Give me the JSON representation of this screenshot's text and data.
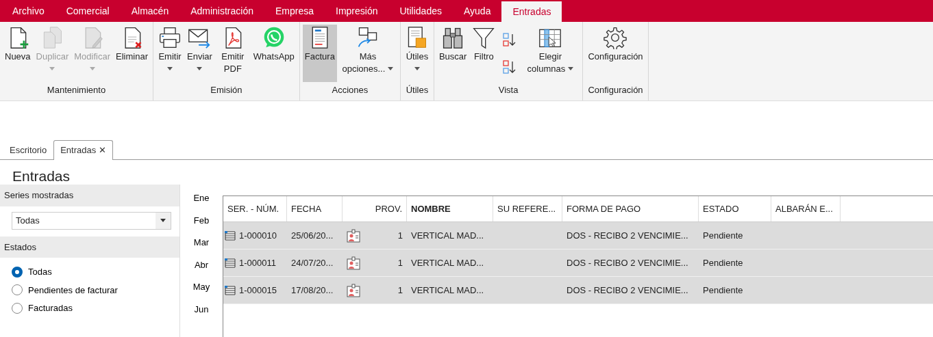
{
  "menu": [
    {
      "label": "Archivo",
      "selected": false
    },
    {
      "label": "Comercial",
      "selected": false
    },
    {
      "label": "Almacén",
      "selected": false
    },
    {
      "label": "Administración",
      "selected": false
    },
    {
      "label": "Empresa",
      "selected": false
    },
    {
      "label": "Impresión",
      "selected": false
    },
    {
      "label": "Utilidades",
      "selected": false
    },
    {
      "label": "Ayuda",
      "selected": false
    },
    {
      "label": "Entradas",
      "selected": true
    }
  ],
  "ribbon": [
    {
      "label": "Mantenimiento",
      "buttons": [
        {
          "kind": "new",
          "label": "Nueva",
          "disabled": false,
          "dropdown": false,
          "selected": false
        },
        {
          "kind": "duplicate",
          "label": "Duplicar",
          "disabled": true,
          "dropdown": true,
          "selected": false
        },
        {
          "kind": "edit",
          "label": "Modificar",
          "disabled": true,
          "dropdown": true,
          "selected": false
        },
        {
          "kind": "delete",
          "label": "Eliminar",
          "disabled": false,
          "dropdown": false,
          "selected": false
        }
      ]
    },
    {
      "label": "Emisión",
      "buttons": [
        {
          "kind": "print",
          "label": "Emitir",
          "disabled": false,
          "dropdown": true,
          "selected": false
        },
        {
          "kind": "mail",
          "label": "Enviar",
          "disabled": false,
          "dropdown": true,
          "selected": false
        },
        {
          "kind": "pdf",
          "label": "Emitir PDF",
          "disabled": false,
          "dropdown": false,
          "selected": false
        },
        {
          "kind": "chat",
          "label": "WhatsApp",
          "disabled": false,
          "dropdown": false,
          "selected": false
        }
      ]
    },
    {
      "label": "Acciones",
      "buttons": [
        {
          "kind": "invoice",
          "label": "Factura",
          "disabled": false,
          "dropdown": false,
          "selected": true
        },
        {
          "kind": "more",
          "label": "Más opciones...",
          "disabled": false,
          "dropdown": true,
          "selected": false
        }
      ]
    },
    {
      "label": "Útiles",
      "buttons": [
        {
          "kind": "tools",
          "label": "Útiles",
          "disabled": false,
          "dropdown": true,
          "selected": false
        }
      ]
    },
    {
      "label": "Vista",
      "buttons": [
        {
          "kind": "search",
          "label": "Buscar",
          "disabled": false,
          "dropdown": false,
          "selected": false
        },
        {
          "kind": "filter",
          "label": "Filtro",
          "disabled": false,
          "dropdown": false,
          "selected": false
        },
        {
          "kind": "sort"
        },
        {
          "kind": "columns",
          "label": "Elegir columnas",
          "disabled": false,
          "dropdown": true,
          "selected": false
        }
      ]
    },
    {
      "label": "Configuración",
      "buttons": [
        {
          "kind": "settings",
          "label": "Configuración",
          "disabled": false,
          "dropdown": false,
          "selected": false
        }
      ]
    }
  ],
  "doc_tabs": [
    {
      "label": "Escritorio",
      "selected": false,
      "closable": false
    },
    {
      "label": "Entradas",
      "selected": true,
      "closable": true
    }
  ],
  "close_glyph": "✕",
  "page_title": "Entradas",
  "series": {
    "heading": "Series mostradas",
    "value": "Todas"
  },
  "estados": {
    "heading": "Estados",
    "options": [
      {
        "label": "Todas",
        "selected": true
      },
      {
        "label": "Pendientes de facturar",
        "selected": false
      },
      {
        "label": "Facturadas",
        "selected": false
      }
    ]
  },
  "months": [
    "Ene",
    "Feb",
    "Mar",
    "Abr",
    "May",
    "Jun"
  ],
  "table": {
    "columns": [
      {
        "label": "SER. - NÚM.",
        "sorted": false
      },
      {
        "label": "FECHA",
        "sorted": false
      },
      {
        "label": "PROV.",
        "sorted": false
      },
      {
        "label": "NOMBRE",
        "sorted": true
      },
      {
        "label": "SU REFERE...",
        "sorted": false
      },
      {
        "label": "FORMA DE PAGO",
        "sorted": false
      },
      {
        "label": "ESTADO",
        "sorted": false
      },
      {
        "label": "ALBARÁN E...",
        "sorted": false
      }
    ],
    "rows": [
      [
        "1-000010",
        "25/06/20...",
        "1",
        "VERTICAL MAD...",
        "",
        "DOS - RECIBO 2 VENCIMIE...",
        "Pendiente",
        ""
      ],
      [
        "1-000011",
        "24/07/20...",
        "1",
        "VERTICAL MAD...",
        "",
        "DOS - RECIBO 2 VENCIMIE...",
        "Pendiente",
        ""
      ],
      [
        "1-000015",
        "17/08/20...",
        "1",
        "VERTICAL MAD...",
        "",
        "DOS - RECIBO 2 VENCIMIE...",
        "Pendiente",
        ""
      ]
    ]
  }
}
